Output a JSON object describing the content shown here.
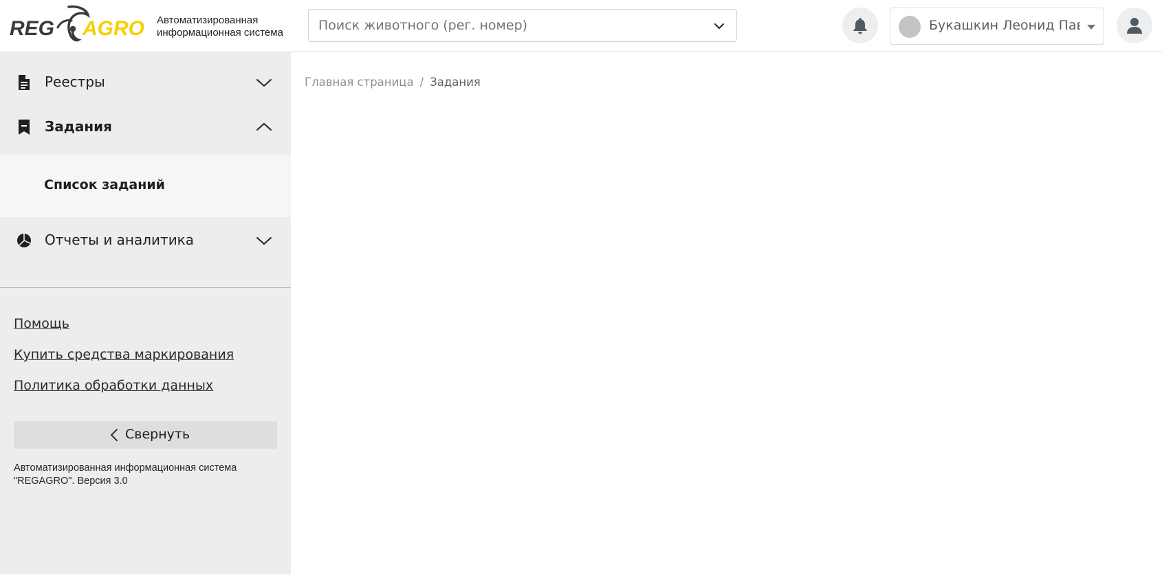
{
  "header": {
    "logo_text_left": "REG",
    "logo_text_right": "AGRO",
    "subtitle_line1": "Автоматизированная",
    "subtitle_line2": "информационная система",
    "search": {
      "placeholder": "Поиск животного (рег. номер)",
      "value": ""
    },
    "user_name": "Букашкин Леонид Павло",
    "icons": {
      "notifications": "bell-icon",
      "profile": "user-icon",
      "search_dropdown": "chevron-down-icon"
    }
  },
  "sidebar": {
    "items": [
      {
        "label": "Реестры",
        "icon": "document-icon",
        "expanded": false
      },
      {
        "label": "Задания",
        "icon": "bookmark-icon",
        "expanded": true,
        "children": [
          {
            "label": "Список заданий"
          }
        ]
      },
      {
        "label": "Отчеты и аналитика",
        "icon": "pie-chart-icon",
        "expanded": false
      }
    ],
    "links": [
      {
        "label": "Помощь"
      },
      {
        "label": "Купить средства маркирования"
      },
      {
        "label": "Политика обработки данных"
      }
    ],
    "collapse_label": "Свернуть",
    "version_line1": "Автоматизированная информационная система",
    "version_line2": "\"REGAGRO\". Версия 3.0"
  },
  "breadcrumb": {
    "home": "Главная страница",
    "separator": "/",
    "current": "Задания"
  },
  "colors": {
    "brand_yellow": "#f5d000",
    "brand_dark": "#3a3a3a",
    "sidebar_bg": "#ededed",
    "subnav_bg": "#f6f6f6"
  }
}
